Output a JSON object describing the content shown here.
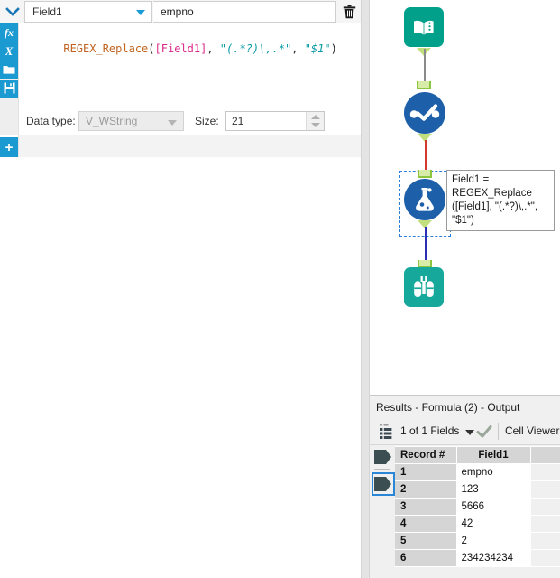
{
  "formula_panel": {
    "collapse_icon": "chevron-down-icon",
    "field_select_value": "Field1",
    "field_name_value": "empno",
    "delete_icon": "trash-icon",
    "rail_buttons": [
      {
        "name": "functions-button",
        "glyph": "fx"
      },
      {
        "name": "variables-button",
        "glyph": "X"
      },
      {
        "name": "open-formula-button",
        "glyph": "folder-icon"
      },
      {
        "name": "save-formula-button",
        "glyph": "save-icon"
      }
    ],
    "add_field_label": "+",
    "formula_tokens": [
      {
        "text": "REGEX_Replace",
        "type": "fn"
      },
      {
        "text": "(",
        "type": "plain"
      },
      {
        "text": "[Field1]",
        "type": "field"
      },
      {
        "text": ", ",
        "type": "plain"
      },
      {
        "text": "\"(.*?)\\,.*\"",
        "type": "str"
      },
      {
        "text": ", ",
        "type": "plain"
      },
      {
        "text": "\"$1\"",
        "type": "str"
      },
      {
        "text": ")",
        "type": "plain"
      }
    ],
    "data_type_label": "Data type:",
    "data_type_value": "V_WString",
    "size_label": "Size:",
    "size_value": "21"
  },
  "canvas": {
    "nodes": [
      {
        "name": "input-data-node",
        "icon": "book-folder-icon",
        "tool": "Input Data"
      },
      {
        "name": "select-node",
        "icon": "check-circle-icon",
        "tool": "Select"
      },
      {
        "name": "formula-node",
        "icon": "flask-icon",
        "tool": "Formula",
        "selected": true
      },
      {
        "name": "browse-node",
        "icon": "binoculars-icon",
        "tool": "Browse"
      }
    ],
    "annotation_text": "Field1 =\nREGEX_Replace\n([Field1], \"(.*?)\\,.*\",\n\"$1\")",
    "connection_colors": {
      "input_to_select": "#8a8a8a",
      "select_to_formula": "#d23b2e",
      "formula_to_browse": "#2a2fb5"
    }
  },
  "results": {
    "title": "Results - Formula (2) - Output",
    "fields_count_label": "1 of 1 Fields",
    "fields_caret_icon": "chevron-down-icon",
    "fields_check_icon": "check-icon",
    "fields_list_icon": "list-icon",
    "cell_viewer_label": "Cell Viewer",
    "columns": [
      "Record #",
      "Field1"
    ],
    "rows": [
      {
        "record": "1",
        "field1": "empno"
      },
      {
        "record": "2",
        "field1": "123"
      },
      {
        "record": "3",
        "field1": "5666"
      },
      {
        "record": "4",
        "field1": "42"
      },
      {
        "record": "5",
        "field1": "2"
      },
      {
        "record": "6",
        "field1": "234234234"
      }
    ],
    "record_flags": [
      {
        "name": "record-flag-input",
        "selected": false
      },
      {
        "name": "record-flag-output",
        "selected": true
      }
    ]
  },
  "colors": {
    "accent_blue": "#1b9ad1",
    "teal": "#00a08b",
    "node_blue": "#1e5fa9",
    "anchor_green": "#c2df7e",
    "selection_blue": "#2a87d8"
  }
}
